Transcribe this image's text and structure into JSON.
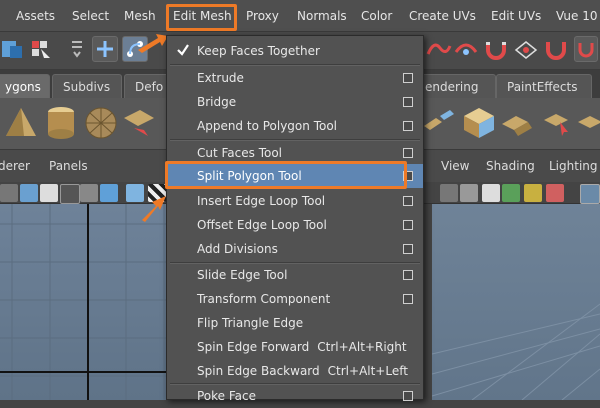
{
  "menubar": {
    "items": [
      "Assets",
      "Select",
      "Mesh",
      "Edit Mesh",
      "Proxy",
      "Normals",
      "Color",
      "Create UVs",
      "Edit UVs",
      "Vue 10"
    ]
  },
  "shelf_tabs": [
    "ygons",
    "Subdivs",
    "Defo",
    "endering",
    "PaintEffects"
  ],
  "panel_menu": {
    "left": [
      "derer",
      "Panels"
    ],
    "right": [
      "View",
      "Shading",
      "Lighting"
    ]
  },
  "dropdown": {
    "items": [
      {
        "label": "Keep Faces Together",
        "checked": true,
        "option_box": false
      },
      {
        "label": "Extrude",
        "option_box": true
      },
      {
        "label": "Bridge",
        "option_box": true
      },
      {
        "label": "Append to Polygon Tool",
        "option_box": true
      },
      {
        "label": "Cut Faces Tool",
        "option_box": true
      },
      {
        "label": "Split Polygon Tool",
        "option_box": true,
        "highlighted": true
      },
      {
        "label": "Insert Edge Loop Tool",
        "option_box": true
      },
      {
        "label": "Offset Edge Loop Tool",
        "option_box": true
      },
      {
        "label": "Add Divisions",
        "option_box": true
      },
      {
        "label": "Slide Edge Tool",
        "option_box": true
      },
      {
        "label": "Transform Component",
        "option_box": true
      },
      {
        "label": "Flip Triangle Edge",
        "option_box": false
      },
      {
        "label": "Spin Edge Forward",
        "shortcut": "Ctrl+Alt+Right"
      },
      {
        "label": "Spin Edge Backward",
        "shortcut": "Ctrl+Alt+Left"
      },
      {
        "label": "Poke Face",
        "option_box": true
      }
    ]
  },
  "colors": {
    "highlight_outline": "#ee7a27",
    "selected_item": "#5f86b3",
    "menu_bg": "#525252"
  }
}
